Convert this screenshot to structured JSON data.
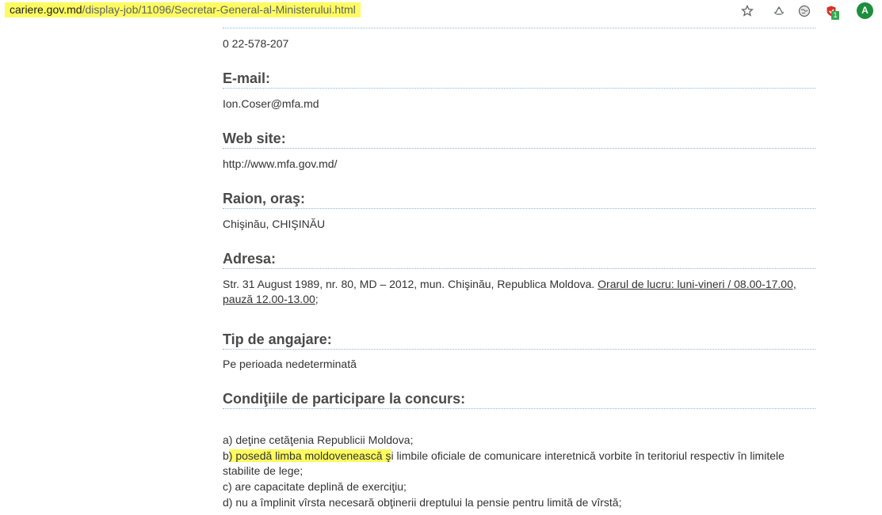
{
  "browser": {
    "url_domain": "cariere.gov.md",
    "url_path": "/display-job/11096/Secretar-General-al-Ministerului.html",
    "avatar_letter": "A",
    "extension_badge": "1",
    "icons": [
      "star-icon",
      "recycle-icon",
      "extension-globe-icon",
      "extension-shield-icon"
    ]
  },
  "job": {
    "phone": "0 22-578-207",
    "email_label": "E-mail:",
    "email": "Ion.Coser@mfa.md",
    "website_label": "Web site:",
    "website": "http://www.mfa.gov.md/",
    "district_label": "Raion, oraş:",
    "district": "Chişinău, CHIŞINĂU",
    "address_label": "Adresa:",
    "address_main": "Str. 31 August 1989, nr. 80, MD – 2012, mun. Chişinău, Republica Moldova.",
    "address_hours_1": "Orarul de lucru: luni-vineri / 08.00-17.00,",
    "address_hours_2": "pauză 12.00-13.00",
    "address_end": ";",
    "employment_label": "Tip de angajare:",
    "employment": "Pe perioada nedeterminată",
    "conditions_label": "Condiţiile de participare la concurs:",
    "cond_a": "a) deţine cetăţenia Republicii Moldova;",
    "cond_b_prefix": "b",
    "cond_b_highlight": ") posedă limba moldovenească ş",
    "cond_b_rest": "i limbile oficiale de comunicare interetnică vorbite în teritoriul respectiv în limitele",
    "cond_b_line2": "stabilite de lege;",
    "cond_c": "c) are capacitate deplină de exerciţiu;",
    "cond_d": "d) nu a împlinit vîrsta necesară obţinerii dreptului la pensie pentru limită de vîrstă;"
  },
  "colors": {
    "highlight": "#fdfb5f",
    "divider": "#8fb8d8",
    "heading": "#4a4a4a",
    "avatar": "#1e8e3e"
  }
}
